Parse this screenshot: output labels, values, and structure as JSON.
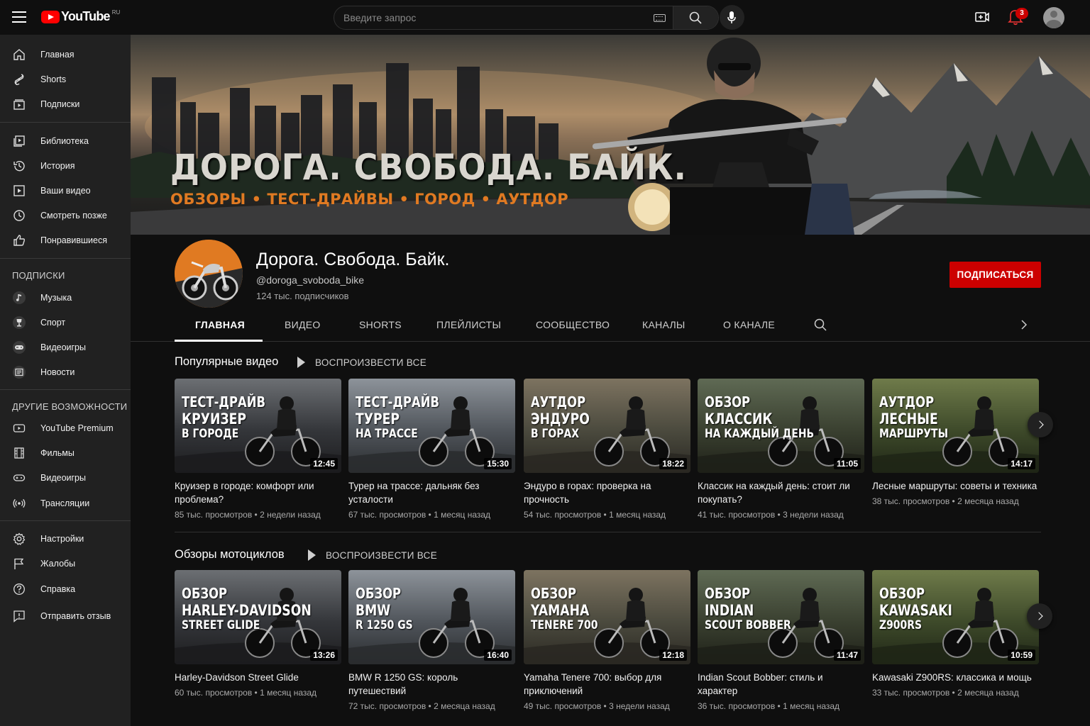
{
  "topbar": {
    "logo_text": "YouTube",
    "logo_region": "RU",
    "search_placeholder": "Введите запрос",
    "notifications_count": "3"
  },
  "sidebar": {
    "main": [
      {
        "label": "Главная",
        "icon": "home-icon"
      },
      {
        "label": "Shorts",
        "icon": "shorts-icon"
      },
      {
        "label": "Подписки",
        "icon": "subscriptions-icon"
      }
    ],
    "library": [
      {
        "label": "Библиотека",
        "icon": "library-icon"
      },
      {
        "label": "История",
        "icon": "history-icon"
      },
      {
        "label": "Ваши видео",
        "icon": "your-videos-icon"
      },
      {
        "label": "Смотреть позже",
        "icon": "watch-later-icon"
      },
      {
        "label": "Понравившиеся",
        "icon": "like-icon"
      }
    ],
    "subscriptions_header": "ПОДПИСКИ",
    "subscriptions": [
      {
        "label": "Музыка",
        "icon": "music-icon"
      },
      {
        "label": "Спорт",
        "icon": "sport-icon"
      },
      {
        "label": "Видеоигры",
        "icon": "gamepad-icon"
      },
      {
        "label": "Новости",
        "icon": "news-icon"
      }
    ],
    "more_header": "ДРУГИЕ ВОЗМОЖНОСТИ",
    "more": [
      {
        "label": "YouTube Premium",
        "icon": "premium-icon"
      },
      {
        "label": "Фильмы",
        "icon": "film-icon"
      },
      {
        "label": "Видеоигры",
        "icon": "gamepad-icon"
      },
      {
        "label": "Трансляции",
        "icon": "live-icon"
      }
    ],
    "footer": [
      {
        "label": "Настройки",
        "icon": "gear-icon"
      },
      {
        "label": "Жалобы",
        "icon": "flag-icon"
      },
      {
        "label": "Справка",
        "icon": "help-icon"
      },
      {
        "label": "Отправить отзыв",
        "icon": "feedback-icon"
      }
    ]
  },
  "banner": {
    "title": "ДОРОГА. СВОБОДА. БАЙК.",
    "subtitle": "ОБЗОРЫ • ТЕСТ-ДРАЙВЫ • ГОРОД • АУТДОР"
  },
  "channel": {
    "name": "Дорога. Свобода. Байк.",
    "handle": "@doroga_svoboda_bike",
    "subscribers": "124 тыс. подписчиков",
    "subscribe_label": "ПОДПИСАТЬСЯ"
  },
  "tabs": [
    "ГЛАВНАЯ",
    "ВИДЕО",
    "SHORTS",
    "ПЛЕЙЛИСТЫ",
    "СООБЩЕСТВО",
    "КАНАЛЫ",
    "О КАНАЛЕ"
  ],
  "sections": [
    {
      "title": "Популярные видео",
      "play_all": "ВОСПРОИЗВЕСТИ ВСЕ",
      "videos": [
        {
          "thumb": [
            "ТЕСТ-ДРАЙВ",
            "КРУИЗЕР",
            "В ГОРОДЕ"
          ],
          "duration": "12:45",
          "title": "Круизер в городе: комфорт или проблема?",
          "meta": "85 тыс. просмотров • 2 недели назад"
        },
        {
          "thumb": [
            "ТЕСТ-ДРАЙВ",
            "ТУРЕР",
            "НА ТРАССЕ"
          ],
          "duration": "15:30",
          "title": "Турер на трассе: дальняк без усталости",
          "meta": "67 тыс. просмотров • 1 месяц назад"
        },
        {
          "thumb": [
            "АУТДОР",
            "ЭНДУРО",
            "В ГОРАХ"
          ],
          "duration": "18:22",
          "title": "Эндуро в горах: проверка на прочность",
          "meta": "54 тыс. просмотров • 1 месяц назад"
        },
        {
          "thumb": [
            "ОБЗОР",
            "КЛАССИК",
            "НА КАЖДЫЙ ДЕНЬ"
          ],
          "duration": "11:05",
          "title": "Классик на каждый день: стоит ли покупать?",
          "meta": "41 тыс. просмотров • 3 недели назад"
        },
        {
          "thumb": [
            "АУТДОР",
            "ЛЕСНЫЕ",
            "МАРШРУТЫ"
          ],
          "duration": "14:17",
          "title": "Лесные маршруты: советы и техника",
          "meta": "38 тыс. просмотров • 2 месяца назад"
        }
      ]
    },
    {
      "title": "Обзоры мотоциклов",
      "play_all": "ВОСПРОИЗВЕСТИ ВСЕ",
      "videos": [
        {
          "thumb": [
            "ОБЗОР",
            "HARLEY-DAVIDSON",
            "STREET GLIDE"
          ],
          "duration": "13:26",
          "title": "Harley-Davidson Street Glide",
          "meta": "60 тыс. просмотров • 1 месяц назад"
        },
        {
          "thumb": [
            "ОБЗОР",
            "BMW",
            "R 1250 GS"
          ],
          "duration": "16:40",
          "title": "BMW R 1250 GS: король путешествий",
          "meta": "72 тыс. просмотров • 2 месяца назад"
        },
        {
          "thumb": [
            "ОБЗОР",
            "YAMAHA",
            "TENERE 700"
          ],
          "duration": "12:18",
          "title": "Yamaha Tenere 700: выбор для приключений",
          "meta": "49 тыс. просмотров • 3 недели назад"
        },
        {
          "thumb": [
            "ОБЗОР",
            "INDIAN",
            "SCOUT BOBBER"
          ],
          "duration": "11:47",
          "title": "Indian Scout Bobber: стиль и характер",
          "meta": "36 тыс. просмотров • 1 месяц назад"
        },
        {
          "thumb": [
            "ОБЗОР",
            "KAWASAKI",
            "Z900RS"
          ],
          "duration": "10:59",
          "title": "Kawasaki Z900RS: классика и мощь",
          "meta": "33 тыс. просмотров • 2 месяца назад"
        }
      ]
    }
  ],
  "colors": {
    "accent_red": "#cc0000",
    "banner_orange": "#e07a22",
    "background": "#0f0f0f",
    "sidebar": "#212121"
  }
}
